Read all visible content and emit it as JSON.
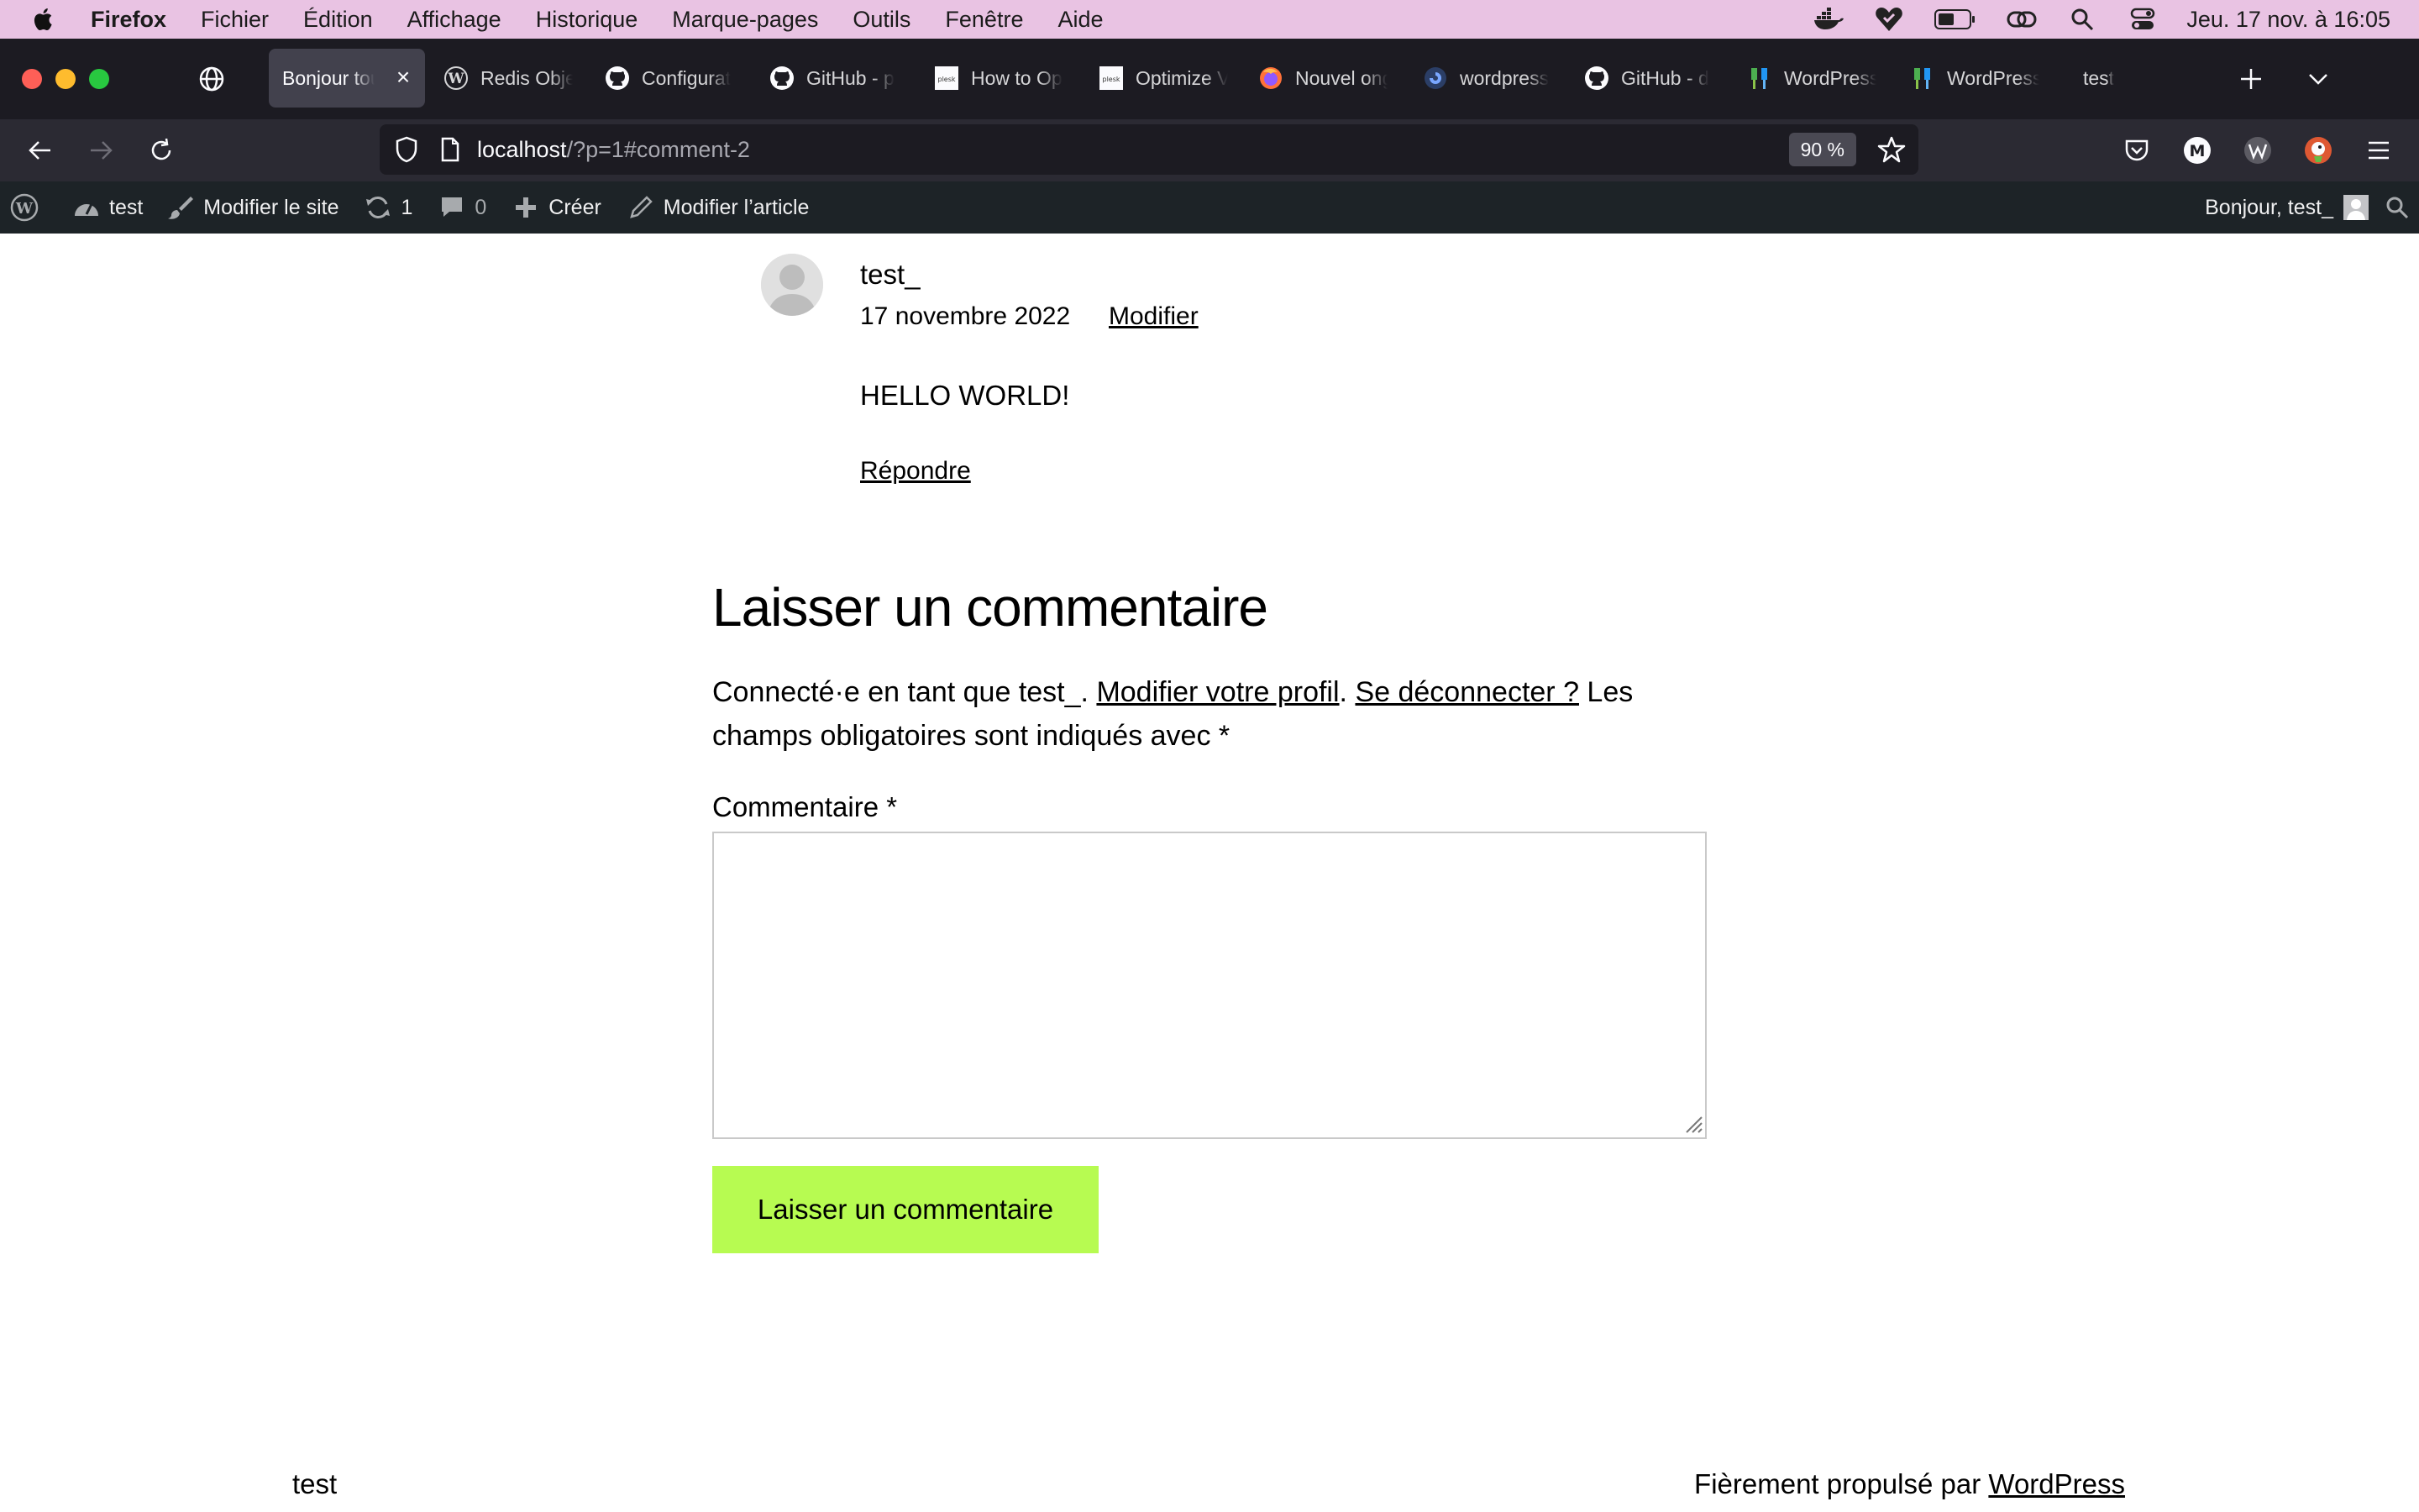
{
  "menubar": {
    "app": "Firefox",
    "items": [
      "Fichier",
      "Édition",
      "Affichage",
      "Historique",
      "Marque-pages",
      "Outils",
      "Fenêtre",
      "Aide"
    ],
    "clock": "Jeu. 17 nov. à  16:05",
    "status_icons": [
      "docker-icon",
      "vpn-heart-icon",
      "battery-icon",
      "link-icon",
      "spotlight-search-icon",
      "control-center-icon"
    ]
  },
  "tabs": [
    {
      "label": "Bonjour tout",
      "icon": "none",
      "active": true
    },
    {
      "label": "Redis Obje",
      "icon": "wordpress-icon"
    },
    {
      "label": "Configurat",
      "icon": "github-icon"
    },
    {
      "label": "GitHub - p",
      "icon": "github-icon"
    },
    {
      "label": "How to Op",
      "icon": "plesk-icon"
    },
    {
      "label": "Optimize V",
      "icon": "plesk-icon"
    },
    {
      "label": "Nouvel ong",
      "icon": "firefox-icon"
    },
    {
      "label": "wordpress",
      "icon": "digitalocean-icon"
    },
    {
      "label": "GitHub - d",
      "icon": "github-icon"
    },
    {
      "label": "WordPress",
      "icon": "wp-plugin-icon"
    },
    {
      "label": "WordPress",
      "icon": "wp-plugin-icon"
    },
    {
      "label": "test",
      "icon": "none"
    }
  ],
  "navbar": {
    "url_host": "localhost",
    "url_path": "/?p=1#comment-2",
    "zoom": "90 %",
    "extensions": {
      "m_letter": "M"
    }
  },
  "adminbar": {
    "site": "test",
    "customize": "Modifier le site",
    "updates": "1",
    "comments": "0",
    "new": "Créer",
    "edit_post": "Modifier l’article",
    "greeting": "Bonjour, test_"
  },
  "comment": {
    "author": "test_",
    "date": "17 novembre 2022",
    "edit": "Modifier",
    "body": "HELLO WORLD!",
    "reply": "Répondre"
  },
  "respond": {
    "title": "Laisser un commentaire",
    "logged_in_prefix": "Connecté·e en tant que test_. ",
    "profile_link": "Modifier votre profil",
    "sep": ". ",
    "logout_link": "Se déconnecter ?",
    "required_note": " Les champs obligatoires sont indiqués avec ",
    "asterisk": "*",
    "comment_label": "Commentaire ",
    "comment_value": "",
    "submit": "Laisser un commentaire"
  },
  "footer": {
    "site": "test",
    "credit_prefix": "Fièrement propulsé par ",
    "credit_link": "WordPress"
  },
  "colors": {
    "menubar_bg": "#e9c3e3",
    "tabbar_bg": "#1c1b22",
    "navbar_bg": "#2b2a33",
    "adminbar_bg": "#1d2327",
    "submit_bg": "#b7fb51"
  }
}
